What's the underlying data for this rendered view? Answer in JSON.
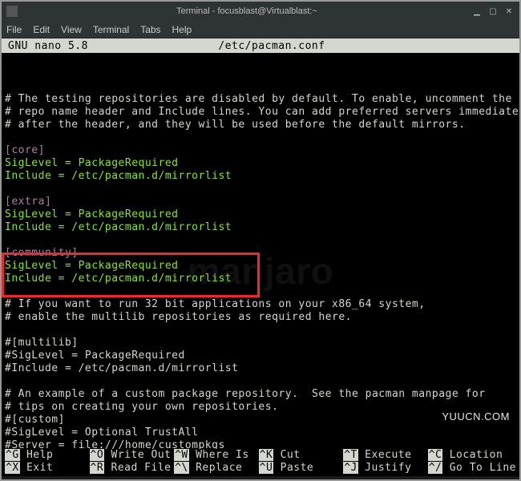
{
  "window": {
    "title": "Terminal - focusblast@Virtualblast:~"
  },
  "menubar": [
    "File",
    "Edit",
    "View",
    "Terminal",
    "Tabs",
    "Help"
  ],
  "nano": {
    "version": "GNU nano 5.8",
    "filename": "/etc/pacman.conf"
  },
  "content": {
    "c1": "# The testing repositories are disabled by default. To enable, uncomment the",
    "c2": "# repo name header and Include lines. You can add preferred servers immediately",
    "c3": "# after the header, and they will be used before the default mirrors.",
    "core_h": "[core]",
    "core_sig": "SigLevel = PackageRequired",
    "core_inc": "Include = /etc/pacman.d/mirrorlist",
    "extra_h": "[extra]",
    "extra_sig": "SigLevel = PackageRequired",
    "extra_inc": "Include = /etc/pacman.d/mirrorlist",
    "comm_h": "[community]",
    "comm_sig": "SigLevel = PackageRequired",
    "comm_inc": "Include = /etc/pacman.d/mirrorlist",
    "c4": "# If you want to run 32 bit applications on your x86_64 system,",
    "c5": "# enable the multilib repositories as required here.",
    "ml_h": "#[multilib]",
    "ml_sig": "#SigLevel = PackageRequired",
    "ml_inc": "#Include = /etc/pacman.d/mirrorlist",
    "c6": "# An example of a custom package repository.  See the pacman manpage for",
    "c7": "# tips on creating your own repositories.",
    "cust_h": "#[custom]",
    "cust_sig": "#SigLevel = Optional TrustAll",
    "cust_srv": "#Server = file:///home/custompkgs"
  },
  "watermark": "manjaro",
  "corner_mark": "YUUCN.COM",
  "footer": [
    {
      "key": "^G",
      "label": "Help"
    },
    {
      "key": "^O",
      "label": "Write Out"
    },
    {
      "key": "^W",
      "label": "Where Is"
    },
    {
      "key": "^K",
      "label": "Cut"
    },
    {
      "key": "^T",
      "label": "Execute"
    },
    {
      "key": "^C",
      "label": "Location"
    },
    {
      "key": "^X",
      "label": "Exit"
    },
    {
      "key": "^R",
      "label": "Read File"
    },
    {
      "key": "^\\",
      "label": "Replace"
    },
    {
      "key": "^U",
      "label": "Paste"
    },
    {
      "key": "^J",
      "label": "Justify"
    },
    {
      "key": "^/",
      "label": "Go To Line"
    }
  ]
}
